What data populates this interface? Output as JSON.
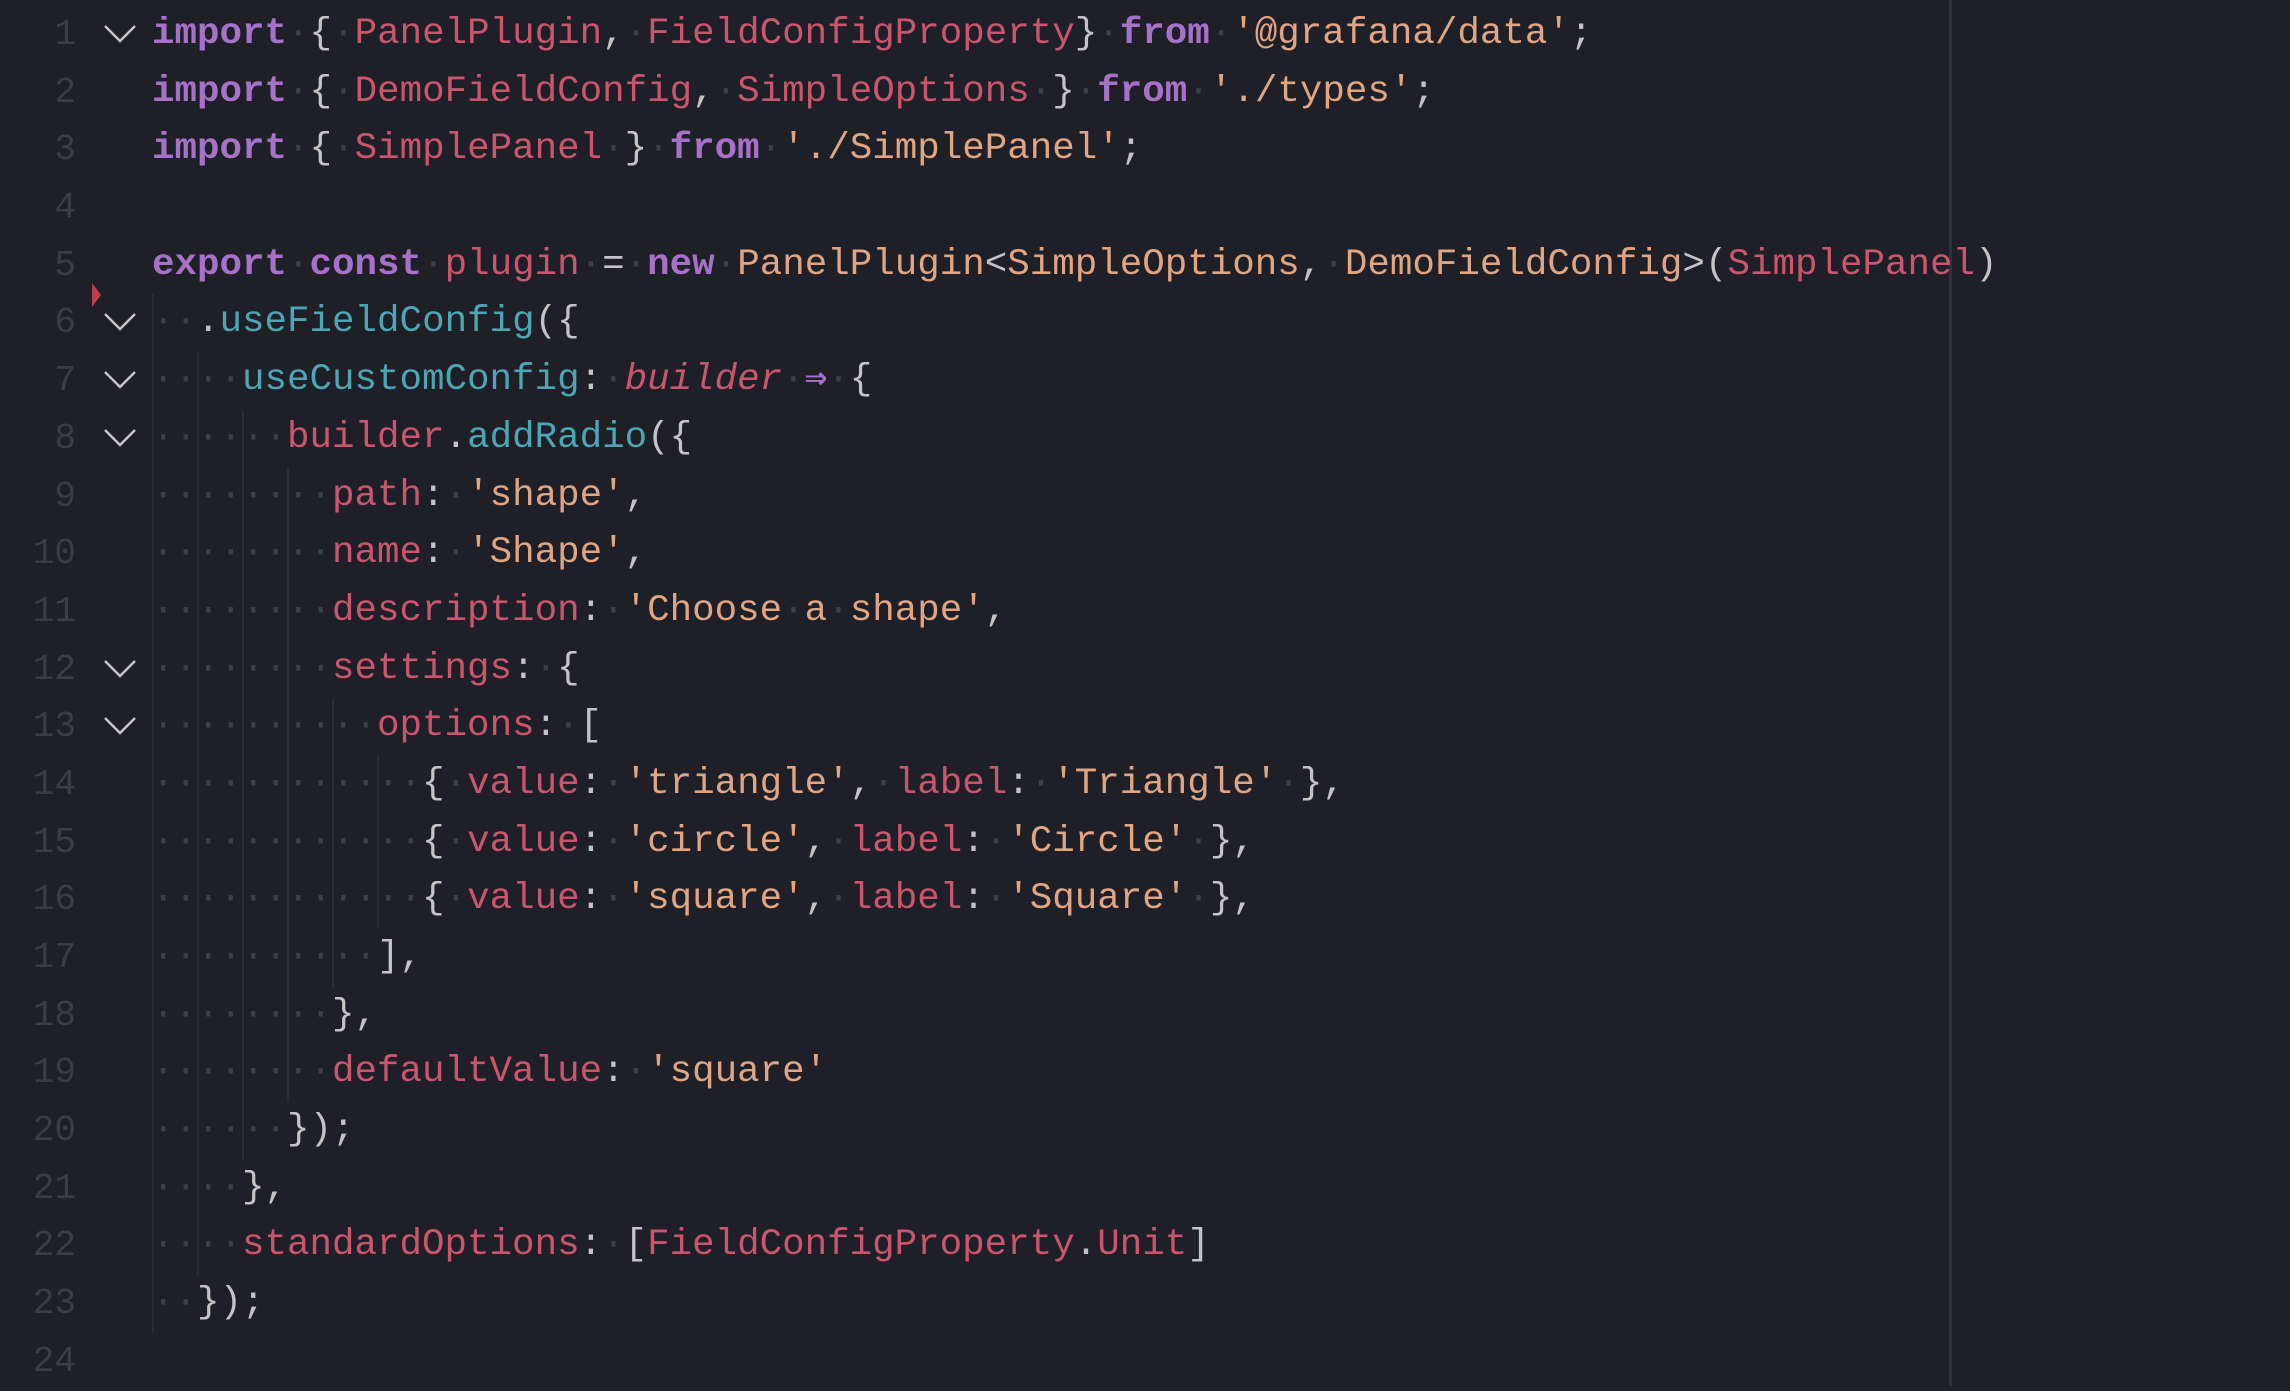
{
  "editor": {
    "language": "typescript",
    "colors": {
      "background": "#1e1f27",
      "keyword": "#a672c8",
      "identifier": "#c9566e",
      "string": "#e0a583",
      "method": "#4da6b3",
      "punctuation": "#c4c4c4",
      "line_number": "#3b3c44",
      "marker": "#c23b4e"
    },
    "lines": [
      {
        "n": "1",
        "fold": true,
        "indent": 0,
        "tokens": [
          [
            "kw",
            "import"
          ],
          [
            "ws",
            " "
          ],
          [
            "pu",
            "{"
          ],
          [
            "ws",
            " "
          ],
          [
            "id",
            "PanelPlugin"
          ],
          [
            "pu",
            ","
          ],
          [
            "ws",
            " "
          ],
          [
            "id",
            "FieldConfigProperty"
          ],
          [
            "pu",
            "}"
          ],
          [
            "ws",
            " "
          ],
          [
            "kw",
            "from"
          ],
          [
            "ws",
            " "
          ],
          [
            "str",
            "'@grafana/data'"
          ],
          [
            "pu",
            ";"
          ]
        ]
      },
      {
        "n": "2",
        "fold": false,
        "indent": 0,
        "tokens": [
          [
            "kw",
            "import"
          ],
          [
            "ws",
            " "
          ],
          [
            "pu",
            "{"
          ],
          [
            "ws",
            " "
          ],
          [
            "id",
            "DemoFieldConfig"
          ],
          [
            "pu",
            ","
          ],
          [
            "ws",
            " "
          ],
          [
            "id",
            "SimpleOptions"
          ],
          [
            "ws",
            " "
          ],
          [
            "pu",
            "}"
          ],
          [
            "ws",
            " "
          ],
          [
            "kw",
            "from"
          ],
          [
            "ws",
            " "
          ],
          [
            "str",
            "'./types'"
          ],
          [
            "pu",
            ";"
          ]
        ]
      },
      {
        "n": "3",
        "fold": false,
        "indent": 0,
        "tokens": [
          [
            "kw",
            "import"
          ],
          [
            "ws",
            " "
          ],
          [
            "pu",
            "{"
          ],
          [
            "ws",
            " "
          ],
          [
            "id",
            "SimplePanel"
          ],
          [
            "ws",
            " "
          ],
          [
            "pu",
            "}"
          ],
          [
            "ws",
            " "
          ],
          [
            "kw",
            "from"
          ],
          [
            "ws",
            " "
          ],
          [
            "str",
            "'./SimplePanel'"
          ],
          [
            "pu",
            ";"
          ]
        ]
      },
      {
        "n": "4",
        "fold": false,
        "indent": 0,
        "tokens": []
      },
      {
        "n": "5",
        "fold": false,
        "indent": 0,
        "tokens": [
          [
            "kw",
            "export"
          ],
          [
            "ws",
            " "
          ],
          [
            "kw",
            "const"
          ],
          [
            "ws",
            " "
          ],
          [
            "id",
            "plugin"
          ],
          [
            "ws",
            " "
          ],
          [
            "pu",
            "="
          ],
          [
            "ws",
            " "
          ],
          [
            "kw",
            "new"
          ],
          [
            "ws",
            " "
          ],
          [
            "cls",
            "PanelPlugin"
          ],
          [
            "pu",
            "<"
          ],
          [
            "cls",
            "SimpleOptions"
          ],
          [
            "pu",
            ","
          ],
          [
            "ws",
            " "
          ],
          [
            "cls",
            "DemoFieldConfig"
          ],
          [
            "pu",
            ">"
          ],
          [
            "pu",
            "("
          ],
          [
            "id",
            "SimplePanel"
          ],
          [
            "pu",
            ")"
          ]
        ]
      },
      {
        "n": "6",
        "fold": true,
        "indent": 1,
        "tokens": [
          [
            "ws",
            "  "
          ],
          [
            "pu",
            "."
          ],
          [
            "fn",
            "useFieldConfig"
          ],
          [
            "pu",
            "({"
          ]
        ]
      },
      {
        "n": "7",
        "fold": true,
        "indent": 2,
        "tokens": [
          [
            "ws",
            "    "
          ],
          [
            "fn",
            "useCustomConfig"
          ],
          [
            "pu",
            ":"
          ],
          [
            "ws",
            " "
          ],
          [
            "param",
            "builder"
          ],
          [
            "ws",
            " "
          ],
          [
            "arrow",
            "⇒"
          ],
          [
            "ws",
            " "
          ],
          [
            "pu",
            "{"
          ]
        ]
      },
      {
        "n": "8",
        "fold": true,
        "indent": 3,
        "tokens": [
          [
            "ws",
            "      "
          ],
          [
            "id",
            "builder"
          ],
          [
            "pu",
            "."
          ],
          [
            "fn",
            "addRadio"
          ],
          [
            "pu",
            "({"
          ]
        ]
      },
      {
        "n": "9",
        "fold": false,
        "indent": 4,
        "tokens": [
          [
            "ws",
            "        "
          ],
          [
            "id",
            "path"
          ],
          [
            "pu",
            ":"
          ],
          [
            "ws",
            " "
          ],
          [
            "str",
            "'shape'"
          ],
          [
            "pu",
            ","
          ]
        ]
      },
      {
        "n": "10",
        "fold": false,
        "indent": 4,
        "tokens": [
          [
            "ws",
            "        "
          ],
          [
            "id",
            "name"
          ],
          [
            "pu",
            ":"
          ],
          [
            "ws",
            " "
          ],
          [
            "str",
            "'Shape'"
          ],
          [
            "pu",
            ","
          ]
        ]
      },
      {
        "n": "11",
        "fold": false,
        "indent": 4,
        "tokens": [
          [
            "ws",
            "        "
          ],
          [
            "id",
            "description"
          ],
          [
            "pu",
            ":"
          ],
          [
            "ws",
            " "
          ],
          [
            "str",
            "'Choose"
          ],
          [
            "ws",
            " "
          ],
          [
            "str",
            "a"
          ],
          [
            "ws",
            " "
          ],
          [
            "str",
            "shape'"
          ],
          [
            "pu",
            ","
          ]
        ]
      },
      {
        "n": "12",
        "fold": true,
        "indent": 4,
        "tokens": [
          [
            "ws",
            "        "
          ],
          [
            "id",
            "settings"
          ],
          [
            "pu",
            ":"
          ],
          [
            "ws",
            " "
          ],
          [
            "pu",
            "{"
          ]
        ]
      },
      {
        "n": "13",
        "fold": true,
        "indent": 5,
        "tokens": [
          [
            "ws",
            "          "
          ],
          [
            "id",
            "options"
          ],
          [
            "pu",
            ":"
          ],
          [
            "ws",
            " "
          ],
          [
            "pu",
            "["
          ]
        ]
      },
      {
        "n": "14",
        "fold": false,
        "indent": 6,
        "tokens": [
          [
            "ws",
            "            "
          ],
          [
            "pu",
            "{"
          ],
          [
            "ws",
            " "
          ],
          [
            "id",
            "value"
          ],
          [
            "pu",
            ":"
          ],
          [
            "ws",
            " "
          ],
          [
            "str",
            "'triangle'"
          ],
          [
            "pu",
            ","
          ],
          [
            "ws",
            " "
          ],
          [
            "id",
            "label"
          ],
          [
            "pu",
            ":"
          ],
          [
            "ws",
            " "
          ],
          [
            "str",
            "'Triangle'"
          ],
          [
            "ws",
            " "
          ],
          [
            "pu",
            "},"
          ]
        ]
      },
      {
        "n": "15",
        "fold": false,
        "indent": 6,
        "tokens": [
          [
            "ws",
            "            "
          ],
          [
            "pu",
            "{"
          ],
          [
            "ws",
            " "
          ],
          [
            "id",
            "value"
          ],
          [
            "pu",
            ":"
          ],
          [
            "ws",
            " "
          ],
          [
            "str",
            "'circle'"
          ],
          [
            "pu",
            ","
          ],
          [
            "ws",
            " "
          ],
          [
            "id",
            "label"
          ],
          [
            "pu",
            ":"
          ],
          [
            "ws",
            " "
          ],
          [
            "str",
            "'Circle'"
          ],
          [
            "ws",
            " "
          ],
          [
            "pu",
            "},"
          ]
        ]
      },
      {
        "n": "16",
        "fold": false,
        "indent": 6,
        "tokens": [
          [
            "ws",
            "            "
          ],
          [
            "pu",
            "{"
          ],
          [
            "ws",
            " "
          ],
          [
            "id",
            "value"
          ],
          [
            "pu",
            ":"
          ],
          [
            "ws",
            " "
          ],
          [
            "str",
            "'square'"
          ],
          [
            "pu",
            ","
          ],
          [
            "ws",
            " "
          ],
          [
            "id",
            "label"
          ],
          [
            "pu",
            ":"
          ],
          [
            "ws",
            " "
          ],
          [
            "str",
            "'Square'"
          ],
          [
            "ws",
            " "
          ],
          [
            "pu",
            "},"
          ]
        ]
      },
      {
        "n": "17",
        "fold": false,
        "indent": 5,
        "tokens": [
          [
            "ws",
            "          "
          ],
          [
            "pu",
            "],"
          ]
        ]
      },
      {
        "n": "18",
        "fold": false,
        "indent": 4,
        "tokens": [
          [
            "ws",
            "        "
          ],
          [
            "pu",
            "},"
          ]
        ]
      },
      {
        "n": "19",
        "fold": false,
        "indent": 4,
        "tokens": [
          [
            "ws",
            "        "
          ],
          [
            "id",
            "defaultValue"
          ],
          [
            "pu",
            ":"
          ],
          [
            "ws",
            " "
          ],
          [
            "str",
            "'square'"
          ]
        ]
      },
      {
        "n": "20",
        "fold": false,
        "indent": 3,
        "tokens": [
          [
            "ws",
            "      "
          ],
          [
            "pu",
            "});"
          ]
        ]
      },
      {
        "n": "21",
        "fold": false,
        "indent": 2,
        "tokens": [
          [
            "ws",
            "    "
          ],
          [
            "pu",
            "},"
          ]
        ]
      },
      {
        "n": "22",
        "fold": false,
        "indent": 2,
        "tokens": [
          [
            "ws",
            "    "
          ],
          [
            "id",
            "standardOptions"
          ],
          [
            "pu",
            ":"
          ],
          [
            "ws",
            " "
          ],
          [
            "pu",
            "["
          ],
          [
            "id",
            "FieldConfigProperty"
          ],
          [
            "pu",
            "."
          ],
          [
            "id",
            "Unit"
          ],
          [
            "pu",
            "]"
          ]
        ]
      },
      {
        "n": "23",
        "fold": false,
        "indent": 1,
        "tokens": [
          [
            "ws",
            "  "
          ],
          [
            "pu",
            "});"
          ]
        ]
      },
      {
        "n": "24",
        "fold": false,
        "indent": 0,
        "tokens": []
      }
    ],
    "breakpoint_marker_line": "6"
  }
}
